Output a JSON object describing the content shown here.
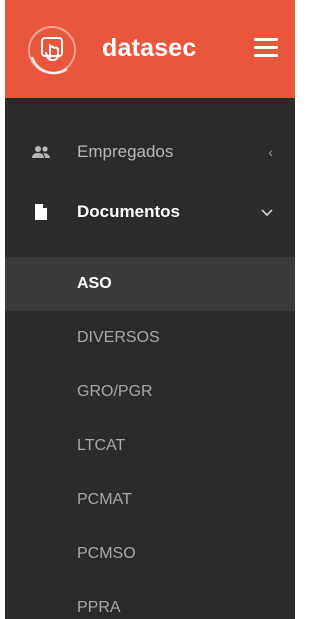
{
  "brand": {
    "name": "datasec",
    "header_color": "#e8563b"
  },
  "menu": {
    "items": [
      {
        "label": "Empregados",
        "icon": "people-icon",
        "chevron": "‹"
      },
      {
        "label": "Documentos",
        "icon": "document-icon",
        "chevron": "⌄"
      }
    ]
  },
  "submenu": {
    "items": [
      {
        "label": "ASO",
        "active": true
      },
      {
        "label": "DIVERSOS"
      },
      {
        "label": "GRO/PGR"
      },
      {
        "label": "LTCAT"
      },
      {
        "label": "PCMAT"
      },
      {
        "label": "PCMSO"
      },
      {
        "label": "PPRA"
      }
    ]
  }
}
